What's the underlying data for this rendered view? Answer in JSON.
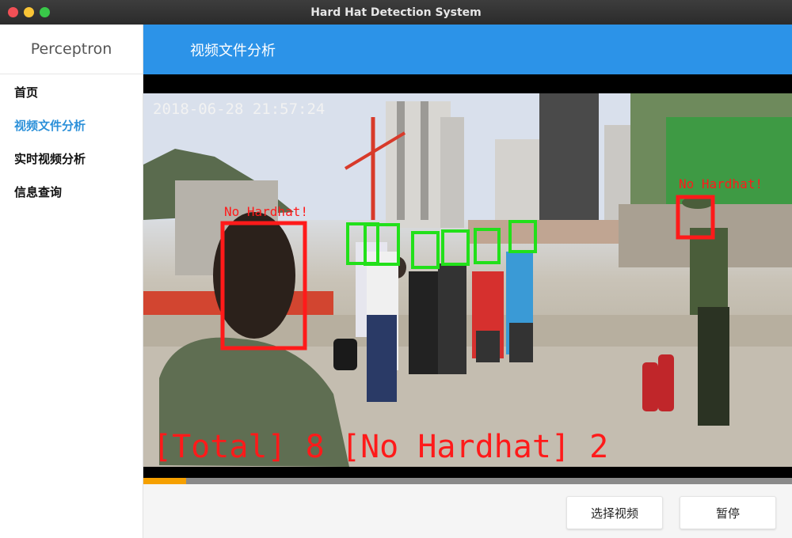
{
  "window": {
    "title": "Hard Hat Detection System"
  },
  "sidebar": {
    "brand": "Perceptron",
    "items": [
      {
        "label": "首页",
        "active": false
      },
      {
        "label": "视频文件分析",
        "active": true
      },
      {
        "label": "实时视频分析",
        "active": false
      },
      {
        "label": "信息查询",
        "active": false
      }
    ]
  },
  "header": {
    "title": "视频文件分析"
  },
  "video": {
    "timestamp": "2018-06-28 21:57:24",
    "detections": [
      {
        "label": "No Hardhat!",
        "status": "no_hardhat"
      },
      {
        "label": "No Hardhat!",
        "status": "no_hardhat"
      },
      {
        "label": "",
        "status": "hardhat"
      },
      {
        "label": "",
        "status": "hardhat"
      },
      {
        "label": "",
        "status": "hardhat"
      },
      {
        "label": "",
        "status": "hardhat"
      },
      {
        "label": "",
        "status": "hardhat"
      },
      {
        "label": "",
        "status": "hardhat"
      }
    ],
    "stats": {
      "total_text": "[Total] 8",
      "no_hardhat_text": "[No Hardhat] 2"
    },
    "progress_fraction": 0.066
  },
  "buttons": {
    "select_video": "选择视频",
    "pause": "暂停"
  },
  "colors": {
    "header": "#2c93e8",
    "active_nav": "#2b90d9",
    "no_hardhat_box": "#ff1a1a",
    "hardhat_box": "#22e01a",
    "progress": "#f5a000"
  }
}
